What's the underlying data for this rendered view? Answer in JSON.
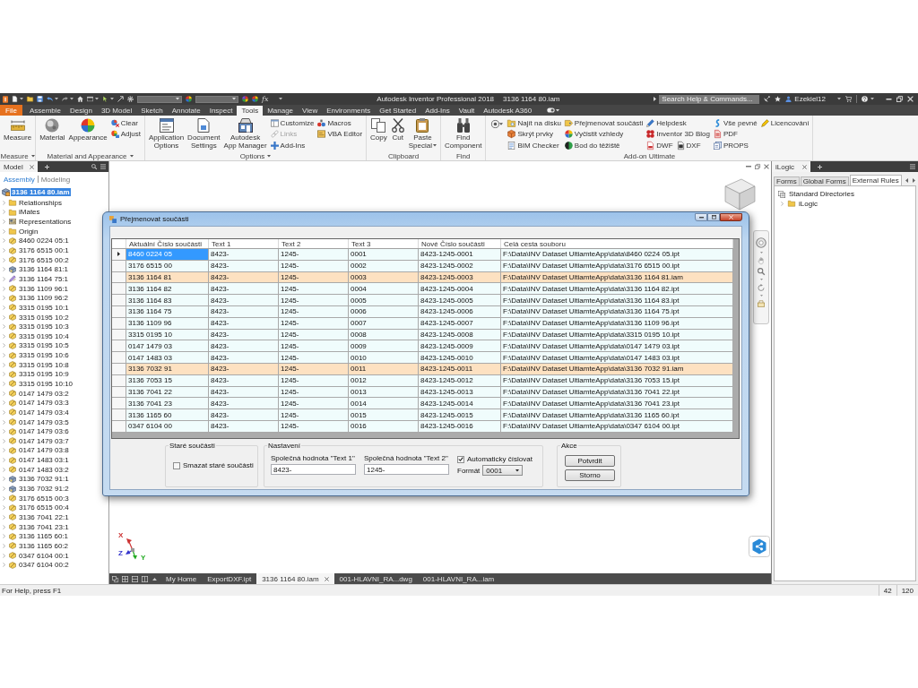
{
  "title_bar": {
    "formula": "fx",
    "title": "Autodesk Inventor Professional 2018",
    "document": "3136 1164 80.iam",
    "search": {
      "placeholder": "Search Help & Commands..."
    },
    "user": "Ezekiel12"
  },
  "tabs": [
    {
      "label": "File",
      "kind": "file",
      "selected": false
    },
    {
      "label": "Assemble",
      "kind": "tab",
      "selected": false
    },
    {
      "label": "Design",
      "kind": "tab",
      "selected": false
    },
    {
      "label": "3D Model",
      "kind": "tab",
      "selected": false
    },
    {
      "label": "Sketch",
      "kind": "tab",
      "selected": false
    },
    {
      "label": "Annotate",
      "kind": "tab",
      "selected": false
    },
    {
      "label": "Inspect",
      "kind": "tab",
      "selected": false
    },
    {
      "label": "Tools",
      "kind": "tab",
      "selected": true
    },
    {
      "label": "Manage",
      "kind": "tab",
      "selected": false
    },
    {
      "label": "View",
      "kind": "tab",
      "selected": false
    },
    {
      "label": "Environments",
      "kind": "tab",
      "selected": false
    },
    {
      "label": "Get Started",
      "kind": "tab",
      "selected": false
    },
    {
      "label": "Add-Ins",
      "kind": "tab",
      "selected": false
    },
    {
      "label": "Vault",
      "kind": "tab",
      "selected": false
    },
    {
      "label": "Autodesk A360",
      "kind": "tab",
      "selected": false
    }
  ],
  "ribbon": [
    {
      "label": "Measure",
      "menu": true,
      "columns": [
        {
          "kind": "large",
          "button": {
            "label": "Measure",
            "menu": false
          }
        }
      ]
    },
    {
      "label": "Material and Appearance",
      "menu": true,
      "columns": [
        {
          "kind": "large",
          "button": {
            "label": "Material",
            "menu": false
          }
        },
        {
          "kind": "large",
          "button": {
            "label": "Appearance",
            "menu": false
          }
        },
        {
          "kind": "stack",
          "rows": [
            [
              {
                "label": "Clear",
                "disabled": false
              }
            ],
            [
              {
                "label": "Adjust",
                "disabled": false
              }
            ]
          ]
        }
      ]
    },
    {
      "label": "Options",
      "menu": true,
      "columns": [
        {
          "kind": "large",
          "button": {
            "label": "Application Options",
            "menu": false
          }
        },
        {
          "kind": "large",
          "button": {
            "label": "Document Settings",
            "menu": false
          }
        },
        {
          "kind": "large",
          "button": {
            "label": "Autodesk App Manager",
            "menu": false
          }
        },
        {
          "kind": "stack",
          "rows": [
            [
              {
                "label": "Customize",
                "disabled": false
              }
            ],
            [
              {
                "label": "Links",
                "disabled": true
              }
            ],
            [
              {
                "label": "Add-Ins",
                "disabled": false
              }
            ]
          ]
        },
        {
          "kind": "stack",
          "rows": [
            [
              {
                "label": "Macros",
                "disabled": false
              }
            ],
            [
              {
                "label": "VBA Editor",
                "disabled": false
              }
            ]
          ]
        }
      ]
    },
    {
      "label": "Clipboard",
      "menu": false,
      "columns": [
        {
          "kind": "large",
          "button": {
            "label": "Copy",
            "menu": false
          }
        },
        {
          "kind": "large",
          "button": {
            "label": "Cut",
            "menu": false
          }
        },
        {
          "kind": "large",
          "button": {
            "label": "Paste Special",
            "menu": true
          }
        }
      ]
    },
    {
      "label": "Find",
      "menu": false,
      "columns": [
        {
          "kind": "large",
          "button": {
            "label": "Find Component",
            "menu": false
          }
        }
      ]
    },
    {
      "label": "Add-on Ultimate",
      "menu": false,
      "columns": [
        {
          "kind": "icon_menu"
        },
        {
          "kind": "stack",
          "rows": [
            [
              {
                "label": "Najít na disku",
                "disabled": false
              }
            ],
            [
              {
                "label": "Skrýt prvky",
                "disabled": false
              }
            ],
            [
              {
                "label": "BIM Checker",
                "disabled": false
              }
            ]
          ]
        },
        {
          "kind": "stack",
          "rows": [
            [
              {
                "label": "Přejmenovat součásti",
                "disabled": false
              }
            ],
            [
              {
                "label": "Vyčistit vzhledy",
                "disabled": false
              }
            ],
            [
              {
                "label": "Bod do těžiště",
                "disabled": false
              }
            ]
          ]
        },
        {
          "kind": "stack",
          "rows": [
            [
              {
                "label": "Helpdesk",
                "disabled": false
              }
            ],
            [
              {
                "label": "Inventor 3D Blog",
                "disabled": false
              }
            ],
            [
              {
                "label": "DWF",
                "disabled": false
              },
              {
                "label": "DXF",
                "disabled": false
              }
            ]
          ]
        },
        {
          "kind": "stack",
          "rows": [
            [
              {
                "label": "Vše pevné",
                "disabled": false
              }
            ],
            [
              {
                "label": "PDF",
                "disabled": false
              }
            ],
            [
              {
                "label": "PROPS",
                "disabled": false
              }
            ]
          ]
        },
        {
          "kind": "stack",
          "rows": [
            [
              {
                "label": "Licencování",
                "disabled": false
              }
            ]
          ]
        }
      ]
    }
  ],
  "browser": {
    "tab": "Model",
    "modes": [
      {
        "label": "Assembly",
        "selected": true
      },
      {
        "label": "Modeling",
        "selected": false
      }
    ],
    "root": {
      "label": "3136 1164 80.iam",
      "selected": true
    },
    "items": [
      {
        "label": "Relationships",
        "kind": "folder",
        "expanded": false
      },
      {
        "label": "iMates",
        "kind": "folder",
        "expanded": false
      },
      {
        "label": "Representations",
        "kind": "views",
        "expanded": false
      },
      {
        "label": "Origin",
        "kind": "folder",
        "expanded": false
      },
      {
        "label": "8460 0224 05:1",
        "kind": "part",
        "expanded": false
      },
      {
        "label": "3176 6515 00:1",
        "kind": "part",
        "expanded": false
      },
      {
        "label": "3176 6515 00:2",
        "kind": "part",
        "expanded": false
      },
      {
        "label": "3136 1164 81:1",
        "kind": "assembly",
        "expanded": false
      },
      {
        "label": "3136 1164 75:1",
        "kind": "edited",
        "expanded": false
      },
      {
        "label": "3136 1109 96:1",
        "kind": "part",
        "expanded": false
      },
      {
        "label": "3136 1109 96:2",
        "kind": "part",
        "expanded": false
      },
      {
        "label": "3315 0195 10:1",
        "kind": "part",
        "expanded": false
      },
      {
        "label": "3315 0195 10:2",
        "kind": "part",
        "expanded": false
      },
      {
        "label": "3315 0195 10:3",
        "kind": "part",
        "expanded": false
      },
      {
        "label": "3315 0195 10:4",
        "kind": "part",
        "expanded": false
      },
      {
        "label": "3315 0195 10:5",
        "kind": "part",
        "expanded": false
      },
      {
        "label": "3315 0195 10:6",
        "kind": "part",
        "expanded": false
      },
      {
        "label": "3315 0195 10:8",
        "kind": "part",
        "expanded": false
      },
      {
        "label": "3315 0195 10:9",
        "kind": "part",
        "expanded": false
      },
      {
        "label": "3315 0195 10:10",
        "kind": "part",
        "expanded": false
      },
      {
        "label": "0147 1479 03:2",
        "kind": "part",
        "expanded": false
      },
      {
        "label": "0147 1479 03:3",
        "kind": "part",
        "expanded": false
      },
      {
        "label": "0147 1479 03:4",
        "kind": "part",
        "expanded": false
      },
      {
        "label": "0147 1479 03:5",
        "kind": "part",
        "expanded": false
      },
      {
        "label": "0147 1479 03:6",
        "kind": "part",
        "expanded": false
      },
      {
        "label": "0147 1479 03:7",
        "kind": "part",
        "expanded": false
      },
      {
        "label": "0147 1479 03:8",
        "kind": "part",
        "expanded": false
      },
      {
        "label": "0147 1483 03:1",
        "kind": "part",
        "expanded": false
      },
      {
        "label": "0147 1483 03:2",
        "kind": "part",
        "expanded": false
      },
      {
        "label": "3136 7032 91:1",
        "kind": "assembly",
        "expanded": false
      },
      {
        "label": "3136 7032 91:2",
        "kind": "assembly",
        "expanded": false
      },
      {
        "label": "3176 6515 00:3",
        "kind": "part",
        "expanded": false
      },
      {
        "label": "3176 6515 00:4",
        "kind": "part",
        "expanded": false
      },
      {
        "label": "3136 7041 22:1",
        "kind": "part",
        "expanded": false
      },
      {
        "label": "3136 7041 23:1",
        "kind": "part",
        "expanded": false
      },
      {
        "label": "3136 1165 60:1",
        "kind": "part",
        "expanded": false
      },
      {
        "label": "3136 1165 60:2",
        "kind": "part",
        "expanded": false
      },
      {
        "label": "0347 6104 00:1",
        "kind": "part",
        "expanded": false
      },
      {
        "label": "0347 6104 00:2",
        "kind": "part",
        "expanded": false
      }
    ]
  },
  "canvas": {
    "axis_labels": [
      "X",
      "Z",
      "Y"
    ]
  },
  "dialog": {
    "title": "Přejmenovat součásti",
    "columns": [
      "Aktuální Číslo součásti",
      "Text 1",
      "Text 2",
      "Text 3",
      "Nové Číslo součásti",
      "Celá cesta souboru"
    ],
    "rows": [
      {
        "cells": [
          "8460 0224 05",
          "8423-",
          "1245-",
          "0001",
          "8423-1245-0001",
          "F:\\Data\\INV Dataset UltiamteApp\\data\\8460 0224 05.ipt"
        ],
        "selected": true,
        "highlighted": false
      },
      {
        "cells": [
          "3176 6515 00",
          "8423-",
          "1245-",
          "0002",
          "8423-1245-0002",
          "F:\\Data\\INV Dataset UltiamteApp\\data\\3176 6515 00.ipt"
        ],
        "selected": false,
        "highlighted": false
      },
      {
        "cells": [
          "3136 1164 81",
          "8423-",
          "1245-",
          "0003",
          "8423-1245-0003",
          "F:\\Data\\INV Dataset UltiamteApp\\data\\3136 1164 81.iam"
        ],
        "selected": false,
        "highlighted": true
      },
      {
        "cells": [
          "3136 1164 82",
          "8423-",
          "1245-",
          "0004",
          "8423-1245-0004",
          "F:\\Data\\INV Dataset UltiamteApp\\data\\3136 1164 82.ipt"
        ],
        "selected": false,
        "highlighted": false
      },
      {
        "cells": [
          "3136 1164 83",
          "8423-",
          "1245-",
          "0005",
          "8423-1245-0005",
          "F:\\Data\\INV Dataset UltiamteApp\\data\\3136 1164 83.ipt"
        ],
        "selected": false,
        "highlighted": false
      },
      {
        "cells": [
          "3136 1164 75",
          "8423-",
          "1245-",
          "0006",
          "8423-1245-0006",
          "F:\\Data\\INV Dataset UltiamteApp\\data\\3136 1164 75.ipt"
        ],
        "selected": false,
        "highlighted": false
      },
      {
        "cells": [
          "3136 1109 96",
          "8423-",
          "1245-",
          "0007",
          "8423-1245-0007",
          "F:\\Data\\INV Dataset UltiamteApp\\data\\3136 1109 96.ipt"
        ],
        "selected": false,
        "highlighted": false
      },
      {
        "cells": [
          "3315 0195 10",
          "8423-",
          "1245-",
          "0008",
          "8423-1245-0008",
          "F:\\Data\\INV Dataset UltiamteApp\\data\\3315 0195 10.ipt"
        ],
        "selected": false,
        "highlighted": false
      },
      {
        "cells": [
          "0147 1479 03",
          "8423-",
          "1245-",
          "0009",
          "8423-1245-0009",
          "F:\\Data\\INV Dataset UltiamteApp\\data\\0147 1479 03.ipt"
        ],
        "selected": false,
        "highlighted": false
      },
      {
        "cells": [
          "0147 1483 03",
          "8423-",
          "1245-",
          "0010",
          "8423-1245-0010",
          "F:\\Data\\INV Dataset UltiamteApp\\data\\0147 1483 03.ipt"
        ],
        "selected": false,
        "highlighted": false
      },
      {
        "cells": [
          "3136 7032 91",
          "8423-",
          "1245-",
          "0011",
          "8423-1245-0011",
          "F:\\Data\\INV Dataset UltiamteApp\\data\\3136 7032 91.iam"
        ],
        "selected": false,
        "highlighted": true
      },
      {
        "cells": [
          "3136 7053 15",
          "8423-",
          "1245-",
          "0012",
          "8423-1245-0012",
          "F:\\Data\\INV Dataset UltiamteApp\\data\\3136 7053 15.ipt"
        ],
        "selected": false,
        "highlighted": false
      },
      {
        "cells": [
          "3136 7041 22",
          "8423-",
          "1245-",
          "0013",
          "8423-1245-0013",
          "F:\\Data\\INV Dataset UltiamteApp\\data\\3136 7041 22.ipt"
        ],
        "selected": false,
        "highlighted": false
      },
      {
        "cells": [
          "3136 7041 23",
          "8423-",
          "1245-",
          "0014",
          "8423-1245-0014",
          "F:\\Data\\INV Dataset UltiamteApp\\data\\3136 7041 23.ipt"
        ],
        "selected": false,
        "highlighted": false
      },
      {
        "cells": [
          "3136 1165 60",
          "8423-",
          "1245-",
          "0015",
          "8423-1245-0015",
          "F:\\Data\\INV Dataset UltiamteApp\\data\\3136 1165 60.ipt"
        ],
        "selected": false,
        "highlighted": false
      },
      {
        "cells": [
          "0347 6104 00",
          "8423-",
          "1245-",
          "0016",
          "8423-1245-0016",
          "F:\\Data\\INV Dataset UltiamteApp\\data\\0347 6104 00.ipt"
        ],
        "selected": false,
        "highlighted": false
      }
    ],
    "old_parts": {
      "title": "Staré součásti",
      "checkbox": {
        "label": "Smazat staré součásti",
        "checked": false
      }
    },
    "settings": {
      "title": "Nastavení",
      "fields": [
        {
          "label": "Společná hodnota \"Text 1\"",
          "value": "8423-"
        },
        {
          "label": "Společná hodnota \"Text 2\"",
          "value": "1245-"
        }
      ],
      "auto_number": {
        "label": "Automaticky číslovat",
        "checked": true
      },
      "format": {
        "label": "Formát",
        "value": "0001"
      }
    },
    "actions": {
      "title": "Akce",
      "buttons": [
        "Potvrdit",
        "Storno"
      ]
    }
  },
  "ilogic": {
    "tab": "iLogic",
    "tabs": [
      {
        "label": "Forms",
        "selected": false
      },
      {
        "label": "Global Forms",
        "selected": false
      },
      {
        "label": "External Rules",
        "selected": true
      }
    ],
    "tree": [
      {
        "label": "Standard Directories",
        "children": [
          {
            "label": "iLogic",
            "expanded": false
          }
        ]
      }
    ]
  },
  "document_tabs": [
    {
      "label": "My Home",
      "selected": false
    },
    {
      "label": "ExportDXF.ipt",
      "selected": false
    },
    {
      "label": "3136 1164 80.iam",
      "selected": true
    },
    {
      "label": "001-HLAVNI_RA...dwg",
      "selected": false
    },
    {
      "label": "001-HLAVNI_RA...iam",
      "selected": false
    }
  ],
  "status_bar": {
    "help": "For Help, press F1",
    "fields": [
      "42",
      "120"
    ]
  }
}
